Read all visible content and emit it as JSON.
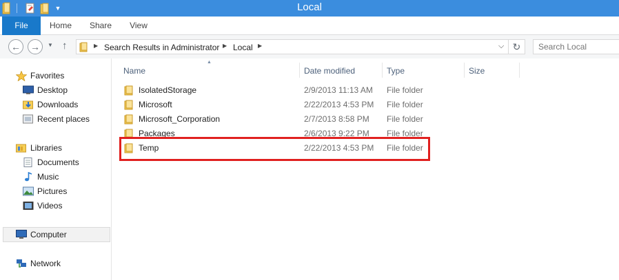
{
  "window": {
    "title": "Local"
  },
  "quick_access": {
    "icons": [
      "folder-icon",
      "properties-icon",
      "new-folder-icon",
      "customize-dropdown-icon"
    ]
  },
  "ribbon": {
    "tabs": [
      {
        "label": "File"
      },
      {
        "label": "Home"
      },
      {
        "label": "Share"
      },
      {
        "label": "View"
      }
    ]
  },
  "address_bar": {
    "breadcrumbs": [
      "Search Results in Administrator",
      "Local"
    ]
  },
  "search": {
    "placeholder": "Search Local"
  },
  "nav_pane": {
    "favorites": {
      "label": "Favorites",
      "items": [
        "Desktop",
        "Downloads",
        "Recent places"
      ]
    },
    "libraries": {
      "label": "Libraries",
      "items": [
        "Documents",
        "Music",
        "Pictures",
        "Videos"
      ]
    },
    "computer": {
      "label": "Computer"
    },
    "network": {
      "label": "Network"
    }
  },
  "file_list": {
    "columns": {
      "name": "Name",
      "date_modified": "Date modified",
      "type": "Type",
      "size": "Size"
    },
    "sorted_by": "Name",
    "rows": [
      {
        "name": "IsolatedStorage",
        "date_modified": "2/9/2013 11:13 AM",
        "type": "File folder",
        "size": ""
      },
      {
        "name": "Microsoft",
        "date_modified": "2/22/2013 4:53 PM",
        "type": "File folder",
        "size": ""
      },
      {
        "name": "Microsoft_Corporation",
        "date_modified": "2/7/2013 8:58 PM",
        "type": "File folder",
        "size": ""
      },
      {
        "name": "Packages",
        "date_modified": "2/6/2013 9:22 PM",
        "type": "File folder",
        "size": ""
      },
      {
        "name": "Temp",
        "date_modified": "2/22/2013 4:53 PM",
        "type": "File folder",
        "size": ""
      }
    ],
    "highlighted_row": "Temp"
  },
  "colors": {
    "title_bar": "#3b8dde",
    "file_tab": "#1979ca",
    "highlight_box": "#e0201f",
    "folder_yellow": "#f6cf57"
  }
}
